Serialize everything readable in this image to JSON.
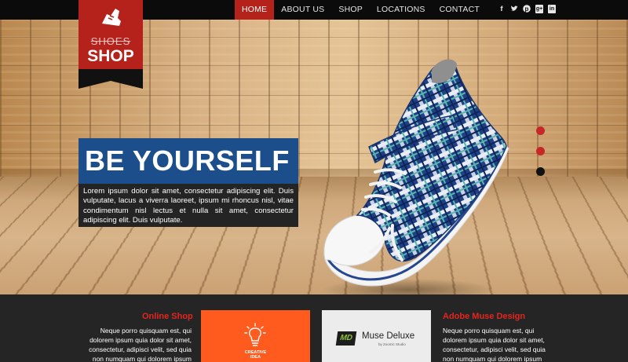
{
  "nav": {
    "items": [
      {
        "label": "HOME",
        "active": true
      },
      {
        "label": "ABOUT US",
        "active": false
      },
      {
        "label": "SHOP",
        "active": false
      },
      {
        "label": "LOCATIONS",
        "active": false
      },
      {
        "label": "CONTACT",
        "active": false
      }
    ]
  },
  "social": [
    "facebook-icon",
    "twitter-icon",
    "pinterest-icon",
    "google-plus-icon",
    "linkedin-icon"
  ],
  "logo": {
    "shoes": "SHOES",
    "shop": "SHOP"
  },
  "hero": {
    "headline": "BE YOURSELF",
    "intro": "Lorem ipsum dolor sit amet, consectetur adipiscing elit. Duis vulputate, lacus a viverra laoreet, ipsum mi rhoncus nisl, vitae condimentum nisl lectus et nulla sit amet, consectetur adipiscing elit. Duis vulputate."
  },
  "slider": {
    "dots": [
      {
        "color": "#c62828"
      },
      {
        "color": "#c62828"
      },
      {
        "color": "#111111"
      }
    ]
  },
  "features": {
    "left": {
      "title": "Online Shop",
      "lines": [
        "Neque porro quisquam est, qui",
        "dolorem ipsum quia dolor sit amet,",
        "consectetur, adipisci velit, sed quia",
        "non numquam qui dolorem ipsum"
      ]
    },
    "creative": {
      "line1": "CREATIVE",
      "line2": "IDEA"
    },
    "muse": {
      "badge": "MD",
      "name": "Muse Deluxe",
      "sub": "by Zoomic Studio"
    },
    "right": {
      "title": "Adobe Muse Design",
      "lines": [
        "Neque porro quisquam est, qui",
        "dolorem ipsum quia dolor sit amet,",
        "consectetur, adipisci velit, sed quia",
        "non numquam qui dolorem ipsum"
      ]
    }
  },
  "colors": {
    "accent": "#b5221c",
    "headline_bg": "#1c4e8b",
    "orange": "#ff5b1f"
  }
}
